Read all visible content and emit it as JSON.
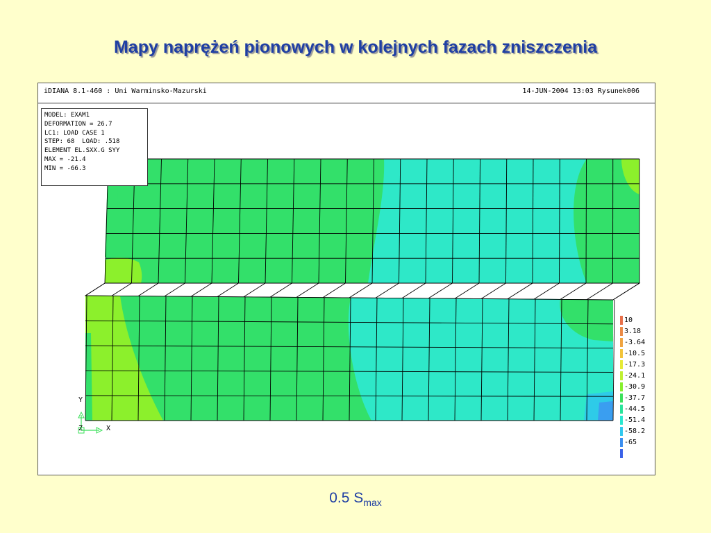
{
  "slide": {
    "title": "Mapy naprężeń pionowych w kolejnych fazach zniszczenia",
    "caption_main": "0.5 S",
    "caption_sub": "max"
  },
  "window": {
    "header_left": "iDIANA 8.1-460 : Uni Warminsko-Mazurski",
    "header_right": "14-JUN-2004 13:03 Rysunek006"
  },
  "info_box": {
    "lines": [
      "MODEL: EXAM1",
      "DEFORMATION = 26.7",
      "LC1: LOAD CASE 1",
      "STEP: 68  LOAD: .518",
      "ELEMENT EL.SXX.G SYY",
      "MAX = -21.4",
      "MIN = -66.3"
    ]
  },
  "axes": {
    "y_label": "Y",
    "z_label": "Z",
    "x_label": "X"
  },
  "legend": {
    "items": [
      {
        "label": "10",
        "color": "#e8704a"
      },
      {
        "label": "3.18",
        "color": "#eb8a46"
      },
      {
        "label": "-3.64",
        "color": "#f0a440"
      },
      {
        "label": "-10.5",
        "color": "#f2c43a"
      },
      {
        "label": "-17.3",
        "color": "#e6ea36"
      },
      {
        "label": "-24.1",
        "color": "#bff030"
      },
      {
        "label": "-30.9",
        "color": "#86ef2c"
      },
      {
        "label": "-37.7",
        "color": "#3be05a"
      },
      {
        "label": "-44.5",
        "color": "#28e49a"
      },
      {
        "label": "-51.4",
        "color": "#2ae8d0"
      },
      {
        "label": "-58.2",
        "color": "#30c8ee"
      },
      {
        "label": "-65",
        "color": "#3a8ef0"
      },
      {
        "label": "",
        "color": "#3a62e8"
      }
    ]
  },
  "colors": {
    "green": "#33e06a",
    "yellow_green": "#8cf02c",
    "cyan": "#2ee8c8",
    "deep_cyan": "#2ecbe8",
    "blue": "#3a9ef0"
  }
}
